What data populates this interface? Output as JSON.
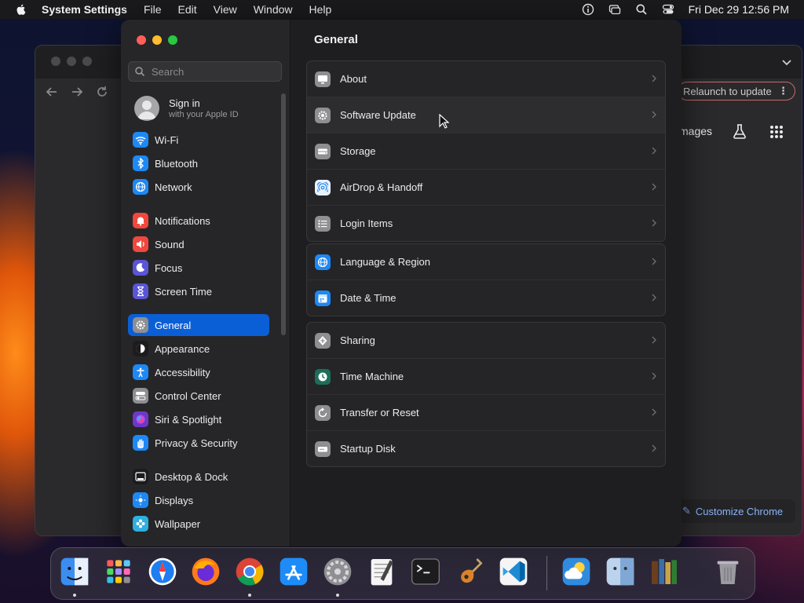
{
  "menubar": {
    "app_name": "System Settings",
    "menus": [
      "File",
      "Edit",
      "View",
      "Window",
      "Help"
    ],
    "clock": "Fri Dec 29  12:56 PM"
  },
  "chrome": {
    "relaunch_label": "Relaunch to update",
    "images_label": "mages",
    "customize_label": "Customize Chrome"
  },
  "settings": {
    "search_placeholder": "Search",
    "account": {
      "title": "Sign in",
      "subtitle": "with your Apple ID"
    },
    "sidebar": [
      {
        "label": "Wi-Fi",
        "icon": "wifi-icon",
        "color": "#1e88f5"
      },
      {
        "label": "Bluetooth",
        "icon": "bluetooth-icon",
        "color": "#1e88f5"
      },
      {
        "label": "Network",
        "icon": "globe-icon",
        "color": "#1e88f5"
      },
      {
        "label": "Notifications",
        "icon": "bell-icon",
        "color": "#f0473e"
      },
      {
        "label": "Sound",
        "icon": "speaker-icon",
        "color": "#f0473e"
      },
      {
        "label": "Focus",
        "icon": "moon-icon",
        "color": "#5a55d6"
      },
      {
        "label": "Screen Time",
        "icon": "hourglass-icon",
        "color": "#5a55d6"
      },
      {
        "label": "General",
        "icon": "gear-icon",
        "color": "#8e8e93",
        "active": true
      },
      {
        "label": "Appearance",
        "icon": "appearance-icon",
        "color": "#1c1c1e"
      },
      {
        "label": "Accessibility",
        "icon": "accessibility-icon",
        "color": "#1e88f5"
      },
      {
        "label": "Control Center",
        "icon": "toggles-icon",
        "color": "#8e8e93"
      },
      {
        "label": "Siri & Spotlight",
        "icon": "siri-icon",
        "color": "#6d38c8"
      },
      {
        "label": "Privacy & Security",
        "icon": "hand-icon",
        "color": "#1e88f5"
      },
      {
        "label": "Desktop & Dock",
        "icon": "dock-icon",
        "color": "#1c1c1e"
      },
      {
        "label": "Displays",
        "icon": "sun-icon",
        "color": "#1e88f5"
      },
      {
        "label": "Wallpaper",
        "icon": "flower-icon",
        "color": "#30b0e0"
      }
    ],
    "page_title": "General",
    "groups": [
      [
        {
          "label": "About",
          "icon": "display-icon",
          "color": "#8e8e93"
        },
        {
          "label": "Software Update",
          "icon": "gear-badge-icon",
          "color": "#8e8e93"
        },
        {
          "label": "Storage",
          "icon": "drive-icon",
          "color": "#8e8e93"
        },
        {
          "label": "AirDrop & Handoff",
          "icon": "airdrop-icon",
          "color": "#e8f2ff"
        },
        {
          "label": "Login Items",
          "icon": "list-icon",
          "color": "#8e8e93"
        }
      ],
      [
        {
          "label": "Language & Region",
          "icon": "globe-icon",
          "color": "#1e88f5"
        },
        {
          "label": "Date & Time",
          "icon": "calendar-icon",
          "color": "#1e88f5"
        }
      ],
      [
        {
          "label": "Sharing",
          "icon": "sharing-icon",
          "color": "#8e8e93"
        },
        {
          "label": "Time Machine",
          "icon": "time-machine-icon",
          "color": "#1c6e5a"
        },
        {
          "label": "Transfer or Reset",
          "icon": "reset-icon",
          "color": "#8e8e93"
        },
        {
          "label": "Startup Disk",
          "icon": "disk-icon",
          "color": "#8e8e93"
        }
      ]
    ]
  },
  "dock": [
    {
      "name": "Finder",
      "icon": "finder-icon",
      "color": "#3b8ef0",
      "running": true
    },
    {
      "name": "Launchpad",
      "icon": "launchpad-icon",
      "color": "#d9d9de"
    },
    {
      "name": "Safari",
      "icon": "safari-icon",
      "color": "#1e7df0"
    },
    {
      "name": "Firefox",
      "icon": "firefox-icon",
      "color": "#6a2bd9"
    },
    {
      "name": "Chrome",
      "icon": "chrome-icon",
      "color": "#f2f2f2",
      "running": true
    },
    {
      "name": "App Store",
      "icon": "app-store-icon",
      "color": "#1d8cf8"
    },
    {
      "name": "System Settings",
      "icon": "settings-gear-icon",
      "color": "#8e8e93",
      "running": true
    },
    {
      "name": "TextEdit",
      "icon": "textedit-icon",
      "color": "#f5f5f5"
    },
    {
      "name": "Terminal",
      "icon": "terminal-icon",
      "color": "#1c1c1e"
    },
    {
      "name": "GarageBand",
      "icon": "guitar-icon",
      "color": "#3a2a1a"
    },
    {
      "name": "VS Code",
      "icon": "vscode-icon",
      "color": "#f5f5f5"
    },
    {
      "name": "Weather",
      "icon": "weather-icon",
      "color": "#2f8be0"
    },
    {
      "name": "Finder Folder",
      "icon": "finder-alt-icon",
      "color": "#bcd3ee"
    },
    {
      "name": "Calibre",
      "icon": "books-icon",
      "color": "#6b3f1e"
    },
    {
      "name": "Trash",
      "icon": "trash-icon",
      "color": "#9a9aa0"
    }
  ]
}
